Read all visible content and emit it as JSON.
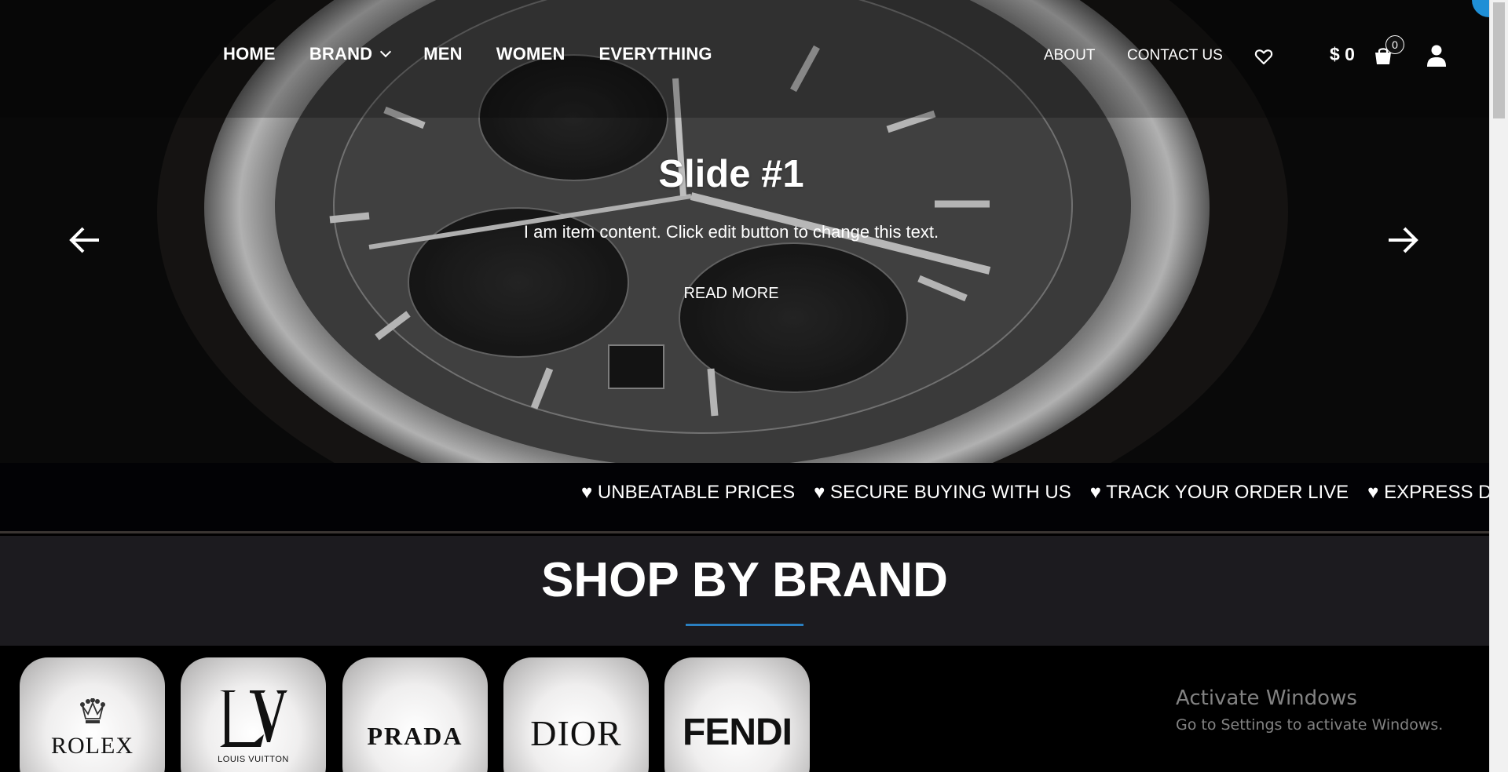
{
  "nav": {
    "main": [
      {
        "label": "HOME"
      },
      {
        "label": "BRAND"
      },
      {
        "label": "MEN"
      },
      {
        "label": "WOMEN"
      },
      {
        "label": "EVERYTHING"
      }
    ],
    "about": "ABOUT",
    "contact": "CONTACT US",
    "cart_total": "$ 0",
    "cart_count": "0"
  },
  "slide": {
    "title": "Slide #1",
    "text": "I am item content. Click edit button to change this text.",
    "cta": "READ MORE"
  },
  "ticker": [
    "♥ UNBEATABLE PRICES",
    "♥ SECURE BUYING WITH US",
    "♥ TRACK YOUR ORDER LIVE",
    "♥ EXPRESS DE"
  ],
  "section": {
    "title": "SHOP BY BRAND"
  },
  "brands": {
    "rolex": "ROLEX",
    "lv": "LOUIS VUITTON",
    "prada": "PRADA",
    "dior": "DIOR",
    "fendi": "FENDI"
  },
  "watermark": {
    "title": "Activate Windows",
    "subtitle": "Go to Settings to activate Windows."
  },
  "icons": {
    "wishlist": "heart-icon",
    "cart": "shopping-bag-icon",
    "account": "user-icon",
    "prev": "arrow-left-icon",
    "next": "arrow-right-icon"
  },
  "colors": {
    "accent_underline": "#2a7fc0",
    "section_bg": "#1c1b1f",
    "ticker_bg": "#020205"
  }
}
